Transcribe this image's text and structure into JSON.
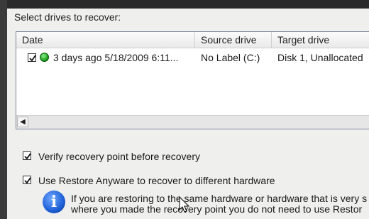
{
  "section_label": "Select drives to recover:",
  "table": {
    "columns": [
      "Date",
      "Source drive",
      "Target drive"
    ],
    "rows": [
      {
        "checked": true,
        "status": "green",
        "date": "3 days ago 5/18/2009 6:11...",
        "source": "No Label (C:)",
        "target": "Disk 1, Unallocated"
      }
    ]
  },
  "options": [
    {
      "checked": true,
      "label": "Verify recovery point before recovery"
    },
    {
      "checked": true,
      "label": "Use Restore Anyware to recover to different hardware"
    }
  ],
  "info": {
    "line1": "If you are restoring to the same hardware or hardware that is very s",
    "line2": "where you made the recovery point you do not need to use Restor"
  },
  "icons": {
    "status_icon": "green-status-icon",
    "info_icon": "info-icon",
    "scroll_left": "scroll-left-arrow-icon",
    "cursor": "mouse-cursor-icon"
  }
}
